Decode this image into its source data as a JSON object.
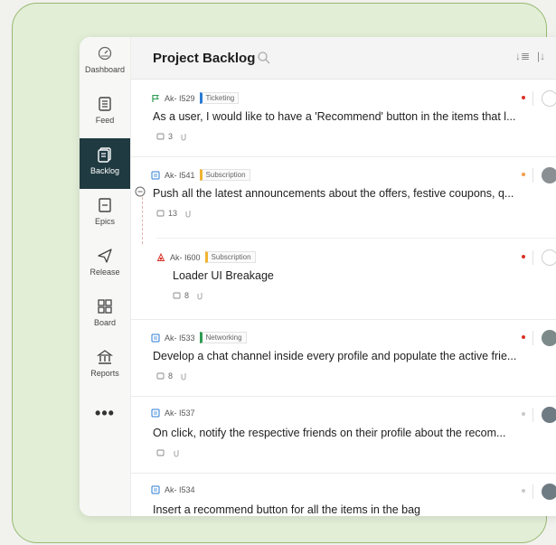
{
  "sidebar": {
    "items": [
      {
        "label": "Dashboard",
        "icon": "dashboard-icon"
      },
      {
        "label": "Feed",
        "icon": "feed-icon"
      },
      {
        "label": "Backlog",
        "icon": "backlog-icon",
        "active": true
      },
      {
        "label": "Epics",
        "icon": "epics-icon"
      },
      {
        "label": "Release",
        "icon": "release-icon"
      },
      {
        "label": "Board",
        "icon": "board-icon"
      },
      {
        "label": "Reports",
        "icon": "reports-icon"
      }
    ],
    "more": "•••"
  },
  "header": {
    "title": "Project Backlog",
    "sort1": "↓≣",
    "sort2": "|↓"
  },
  "colors": {
    "ticketing": "#2a7bd4",
    "subscription": "#f0b431",
    "networking": "#2e9b52",
    "priority_high": "#d93025",
    "priority_medium": "#f29c4a",
    "priority_low": "#c8c8c8",
    "active_nav": "#1f3a40"
  },
  "items": [
    {
      "id": "Ak- I529",
      "tag": "Ticketing",
      "summary": "As a user, I would like to have a 'Recommend' button in the items that l...",
      "comments": "3",
      "type_icon": "story-flag-icon"
    },
    {
      "id": "Ak- I541",
      "tag": "Subscription",
      "summary": "Push all the latest announcements about the offers, festive coupons, q...",
      "comments": "13",
      "type_icon": "story-icon"
    },
    {
      "id": "Ak- I600",
      "tag": "Subscription",
      "summary": "Loader UI Breakage",
      "comments": "8",
      "type_icon": "bug-icon"
    },
    {
      "id": "Ak- I533",
      "tag": "Networking",
      "summary": "Develop a chat channel inside every profile and populate the active frie...",
      "comments": "8",
      "type_icon": "story-icon"
    },
    {
      "id": "Ak- I537",
      "tag": "",
      "summary": "On click, notify the respective friends on their profile about the recom...",
      "comments": "",
      "type_icon": "story-icon"
    },
    {
      "id": "Ak- I534",
      "tag": "",
      "summary": "Insert a recommend button for all the items in the bag",
      "comments": "",
      "type_icon": "story-icon"
    }
  ]
}
